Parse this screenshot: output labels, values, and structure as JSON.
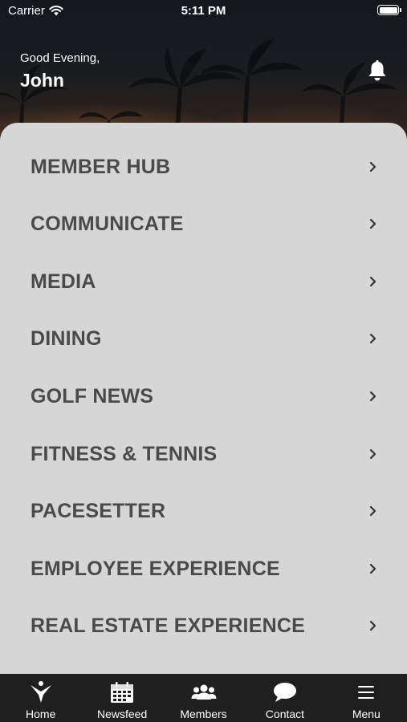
{
  "status_bar": {
    "carrier": "Carrier",
    "time": "5:11 PM"
  },
  "header": {
    "greeting": "Good Evening,",
    "username": "John",
    "bell_icon": "bell-icon"
  },
  "menu": {
    "items": [
      {
        "label": "MEMBER HUB"
      },
      {
        "label": "COMMUNICATE"
      },
      {
        "label": "MEDIA"
      },
      {
        "label": "DINING"
      },
      {
        "label": "GOLF NEWS"
      },
      {
        "label": "FITNESS & TENNIS"
      },
      {
        "label": "PACESETTER"
      },
      {
        "label": "EMPLOYEE EXPERIENCE"
      },
      {
        "label": "REAL ESTATE EXPERIENCE"
      }
    ]
  },
  "tabbar": {
    "tabs": [
      {
        "label": "Home",
        "icon": "home-logo-icon"
      },
      {
        "label": "Newsfeed",
        "icon": "calendar-icon"
      },
      {
        "label": "Members",
        "icon": "people-icon"
      },
      {
        "label": "Contact",
        "icon": "chat-bubble-icon"
      },
      {
        "label": "Menu",
        "icon": "hamburger-menu-icon"
      }
    ]
  },
  "colors": {
    "card_background": "#d6d6d6",
    "menu_text": "#4a4a4a",
    "tabbar_background": "#1f1f1f"
  }
}
